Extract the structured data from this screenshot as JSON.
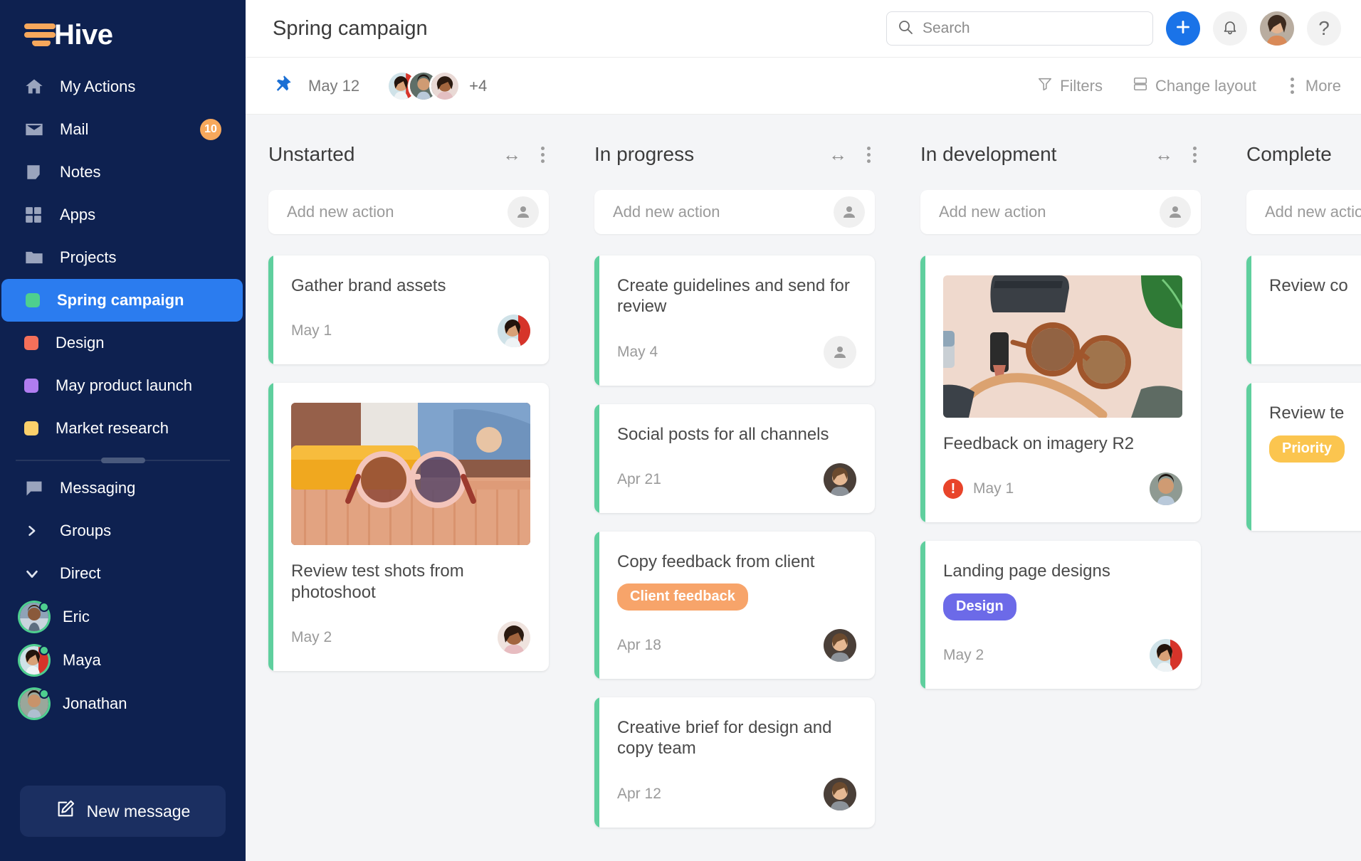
{
  "brand": {
    "name": "Hive",
    "logo_icon": "hive-logo-icon"
  },
  "sidebar": {
    "nav": [
      {
        "label": "My Actions",
        "icon": "home-icon",
        "badge": null
      },
      {
        "label": "Mail",
        "icon": "mail-icon",
        "badge": "10"
      },
      {
        "label": "Notes",
        "icon": "note-icon",
        "badge": null
      },
      {
        "label": "Apps",
        "icon": "apps-grid-icon",
        "badge": null
      },
      {
        "label": "Projects",
        "icon": "folder-icon",
        "badge": null
      }
    ],
    "projects": [
      {
        "label": "Spring campaign",
        "color": "#4ecf8f",
        "active": true
      },
      {
        "label": "Design",
        "color": "#f4705a",
        "active": false
      },
      {
        "label": "May product launch",
        "color": "#b07df0",
        "active": false
      },
      {
        "label": "Market research",
        "color": "#fbd06b",
        "active": false
      }
    ],
    "messaging": {
      "label": "Messaging",
      "icon": "chat-bubble-icon"
    },
    "groups": {
      "label": "Groups",
      "icon": "chevron-right-icon"
    },
    "direct": {
      "label": "Direct",
      "icon": "chevron-down-icon"
    },
    "direct_people": [
      {
        "name": "Eric",
        "status": "online"
      },
      {
        "name": "Maya",
        "status": "online"
      },
      {
        "name": "Jonathan",
        "status": "online"
      }
    ],
    "new_message_button": {
      "label": "New message",
      "icon": "compose-pencil-icon"
    }
  },
  "header": {
    "title": "Spring campaign",
    "search": {
      "placeholder": "Search",
      "value": "",
      "icon": "search-icon"
    },
    "add_button": {
      "icon": "plus-icon",
      "color": "#1a73e8"
    },
    "notifications": {
      "icon": "bell-icon"
    },
    "profile": {
      "icon": "user-avatar"
    },
    "help": {
      "label": "?",
      "icon": "help-question-icon"
    }
  },
  "subheader": {
    "pin": {
      "icon": "pin-icon",
      "color": "#1a6fd4"
    },
    "date": "May 12",
    "members_overflow": "+4",
    "actions": [
      {
        "label": "Filters",
        "icon": "filter-funnel-icon"
      },
      {
        "label": "Change layout",
        "icon": "layout-icon"
      },
      {
        "label": "More",
        "icon": "vertical-dots-icon"
      }
    ]
  },
  "board": {
    "accent_color": "#5fcf9e",
    "add_new_placeholder": "Add new action",
    "columns": [
      {
        "title": "Unstarted",
        "cards": [
          {
            "title": "Gather brand assets",
            "date": "May 1",
            "tag": null,
            "image": null,
            "urgent": false,
            "avatar": "woman-red-scarf"
          },
          {
            "title": "Review test shots from photoshoot",
            "date": "May 2",
            "tag": null,
            "image": "sunglasses-yellow-case-photo",
            "urgent": false,
            "avatar": "woman-curly-hair"
          }
        ]
      },
      {
        "title": "In progress",
        "cards": [
          {
            "title": "Create guidelines and send for review",
            "date": "May 4",
            "tag": null,
            "image": null,
            "urgent": false,
            "avatar": null
          },
          {
            "title": "Social posts for all channels",
            "date": "Apr 21",
            "tag": null,
            "image": null,
            "urgent": false,
            "avatar": "woman-dark-jacket"
          },
          {
            "title": "Copy feedback from client",
            "date": "Apr 18",
            "tag": {
              "label": "Client feedback",
              "color": "#f7a46a"
            },
            "image": null,
            "urgent": false,
            "avatar": "woman-dark-jacket"
          },
          {
            "title": "Creative brief for design and copy team",
            "date": "Apr 12",
            "tag": null,
            "image": null,
            "urgent": false,
            "avatar": "woman-dark-jacket"
          }
        ]
      },
      {
        "title": "In development",
        "cards": [
          {
            "title": "Feedback on imagery R2",
            "date": "May 1",
            "tag": null,
            "image": "flatlay-sunglasses-lipstick-photo",
            "urgent": true,
            "avatar": "man-blue-shirt"
          },
          {
            "title": "Landing page designs",
            "date": "May 2",
            "tag": {
              "label": "Design",
              "color": "#6c6ae8"
            },
            "image": null,
            "urgent": false,
            "avatar": "woman-red-scarf"
          }
        ]
      },
      {
        "title": "Complete",
        "cards": [
          {
            "title": "Review co",
            "date": "",
            "tag": null,
            "image": null,
            "urgent": false,
            "avatar": null
          },
          {
            "title": "Review te",
            "date": "",
            "tag": {
              "label": "Priority",
              "color": "#fbc54f"
            },
            "image": null,
            "urgent": false,
            "avatar": null
          }
        ]
      }
    ]
  }
}
